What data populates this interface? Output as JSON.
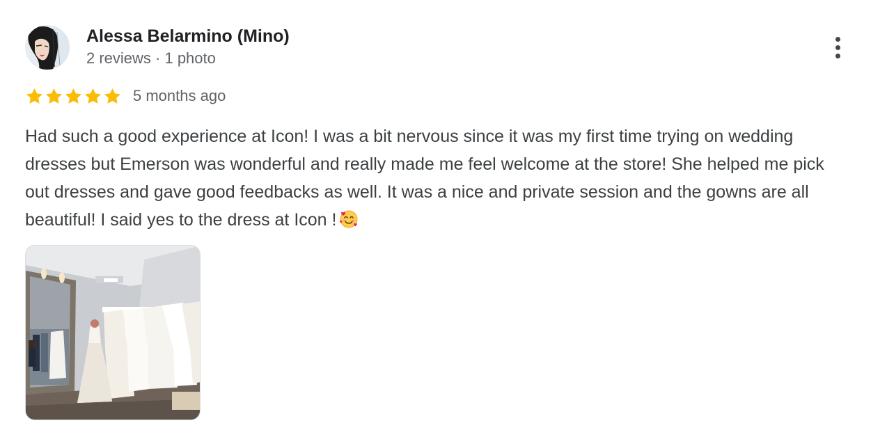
{
  "reviewer": {
    "name": "Alessa Belarmino (Mino)",
    "meta": "2 reviews · 1 photo"
  },
  "review": {
    "rating": 5,
    "max_rating": 5,
    "date": "5 months ago",
    "text": "Had such a good experience at Icon! I was a bit nervous since it was my first time trying on wedding dresses but Emerson was wonderful and really made me feel welcome at the store! She helped me pick out dresses and gave good feedbacks as well. It was a nice and private session and the gowns are all beautiful! I said yes to the dress at Icon !",
    "emoji": "smiling-face-with-hearts"
  },
  "actions": {
    "more_icon": "more-vertical-icon"
  },
  "colors": {
    "star": "#fbbc04",
    "name": "#202124",
    "meta": "#5f6368",
    "text": "#3c4043"
  }
}
